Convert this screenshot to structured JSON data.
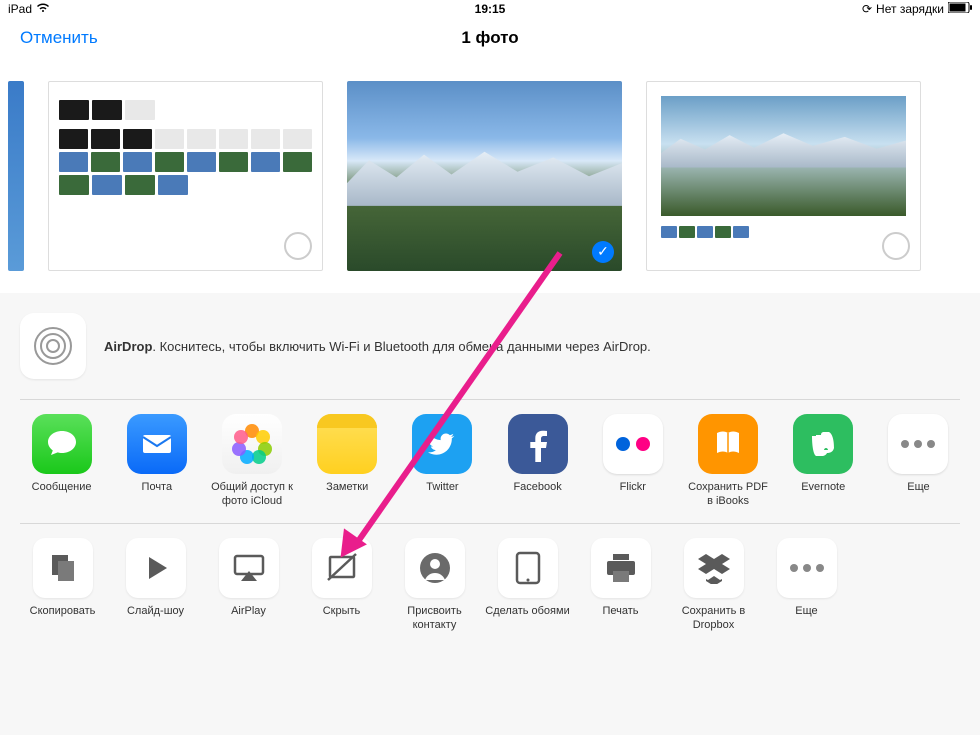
{
  "status": {
    "device": "iPad",
    "time": "19:15",
    "battery": "Нет зарядки"
  },
  "nav": {
    "cancel": "Отменить",
    "title": "1 фото"
  },
  "photos": {
    "selected_index": 1
  },
  "airdrop": {
    "title": "AirDrop",
    "text": ". Коснитесь, чтобы включить Wi-Fi и Bluetooth для обмена данными через AirDrop."
  },
  "apps": [
    {
      "label": "Сообщение"
    },
    {
      "label": "Почта"
    },
    {
      "label": "Общий доступ к фото iCloud"
    },
    {
      "label": "Заметки"
    },
    {
      "label": "Twitter"
    },
    {
      "label": "Facebook"
    },
    {
      "label": "Flickr"
    },
    {
      "label": "Сохранить PDF в iBooks"
    },
    {
      "label": "Evernote"
    },
    {
      "label": "Еще"
    }
  ],
  "actions": [
    {
      "label": "Скопировать"
    },
    {
      "label": "Слайд-шоу"
    },
    {
      "label": "AirPlay"
    },
    {
      "label": "Скрыть"
    },
    {
      "label": "Присвоить контакту"
    },
    {
      "label": "Сделать обоями"
    },
    {
      "label": "Печать"
    },
    {
      "label": "Сохранить в Dropbox"
    },
    {
      "label": "Еще"
    }
  ]
}
